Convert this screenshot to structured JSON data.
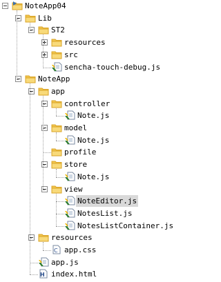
{
  "tree": [
    {
      "label": "NoteApp04",
      "icon": "project-icon",
      "depth": 0,
      "expanded": true
    },
    {
      "label": "Lib",
      "icon": "folder-icon",
      "depth": 1,
      "expanded": true
    },
    {
      "label": "ST2",
      "icon": "folder-icon",
      "depth": 2,
      "expanded": true
    },
    {
      "label": "resources",
      "icon": "folder-icon",
      "depth": 3,
      "expanded": false
    },
    {
      "label": "src",
      "icon": "folder-icon",
      "depth": 3,
      "expanded": false
    },
    {
      "label": "sencha-touch-debug.js",
      "icon": "js-file-icon",
      "depth": 3
    },
    {
      "label": "NoteApp",
      "icon": "folder-icon",
      "depth": 1,
      "expanded": true
    },
    {
      "label": "app",
      "icon": "folder-icon",
      "depth": 2,
      "expanded": true
    },
    {
      "label": "controller",
      "icon": "folder-icon",
      "depth": 3,
      "expanded": true
    },
    {
      "label": "Note.js",
      "icon": "js-file-icon",
      "depth": 4
    },
    {
      "label": "model",
      "icon": "folder-icon",
      "depth": 3,
      "expanded": true
    },
    {
      "label": "Note.js",
      "icon": "js-file-icon",
      "depth": 4
    },
    {
      "label": "profile",
      "icon": "folder-icon",
      "depth": 3
    },
    {
      "label": "store",
      "icon": "folder-icon",
      "depth": 3,
      "expanded": true
    },
    {
      "label": "Note.js",
      "icon": "js-file-icon",
      "depth": 4
    },
    {
      "label": "view",
      "icon": "folder-icon",
      "depth": 3,
      "expanded": true
    },
    {
      "label": "NoteEditor.js",
      "icon": "js-file-icon",
      "depth": 4,
      "selected": true
    },
    {
      "label": "NotesList.js",
      "icon": "js-file-icon",
      "depth": 4
    },
    {
      "label": "NotesListContainer.js",
      "icon": "js-file-icon",
      "depth": 4
    },
    {
      "label": "resources",
      "icon": "folder-icon",
      "depth": 2,
      "expanded": true
    },
    {
      "label": "app.css",
      "icon": "css-file-icon",
      "depth": 3
    },
    {
      "label": "app.js",
      "icon": "js-file-icon",
      "depth": 2
    },
    {
      "label": "index.html",
      "icon": "html-file-icon",
      "depth": 2
    }
  ],
  "colors": {
    "folder": "#f3c74f",
    "folder_dark": "#d9a324",
    "project": "#3a6fb0",
    "selection": "#d9d9d9",
    "connector": "#a0a0a0"
  }
}
